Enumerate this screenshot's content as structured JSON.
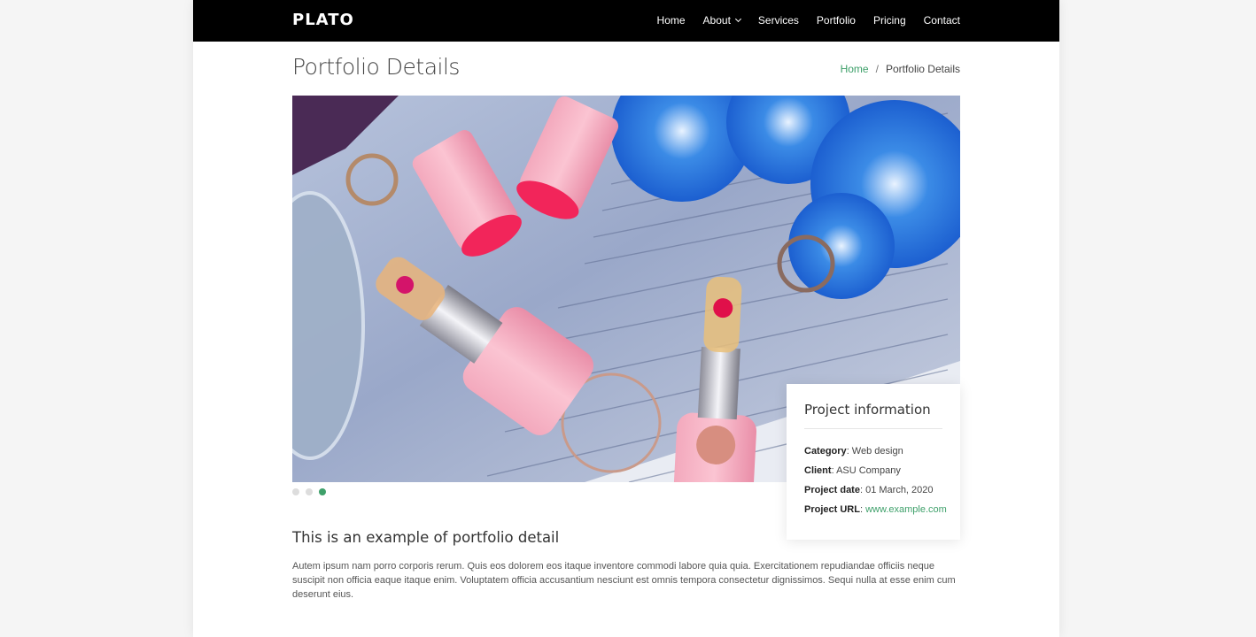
{
  "brand": {
    "logo": "PLATO"
  },
  "nav": {
    "home": "Home",
    "about": "About",
    "services": "Services",
    "portfolio": "Portfolio",
    "pricing": "Pricing",
    "contact": "Contact"
  },
  "header": {
    "title": "Portfolio Details",
    "breadcrumb_home": "Home",
    "breadcrumb_sep": "/",
    "breadcrumb_current": "Portfolio Details"
  },
  "slider": {
    "slide_count": 3,
    "active_index": 2
  },
  "project_info": {
    "title": "Project information",
    "category_label": "Category",
    "category_value": ": Web design",
    "client_label": "Client",
    "client_value": ": ASU Company",
    "date_label": "Project date",
    "date_value": ": 01 March, 2020",
    "url_label": "Project URL",
    "url_sep": ": ",
    "url_value": "www.example.com"
  },
  "content": {
    "heading": "This is an example of portfolio detail",
    "body": "Autem ipsum nam porro corporis rerum. Quis eos dolorem eos itaque inventore commodi labore quia quia. Exercitationem repudiandae officiis neque suscipit non officia eaque itaque enim. Voluptatem officia accusantium nesciunt est omnis tempora consectetur dignissimos. Sequi nulla at esse enim cum deserunt eius."
  },
  "colors": {
    "accent": "#3ea06a",
    "navbar": "#000000"
  }
}
